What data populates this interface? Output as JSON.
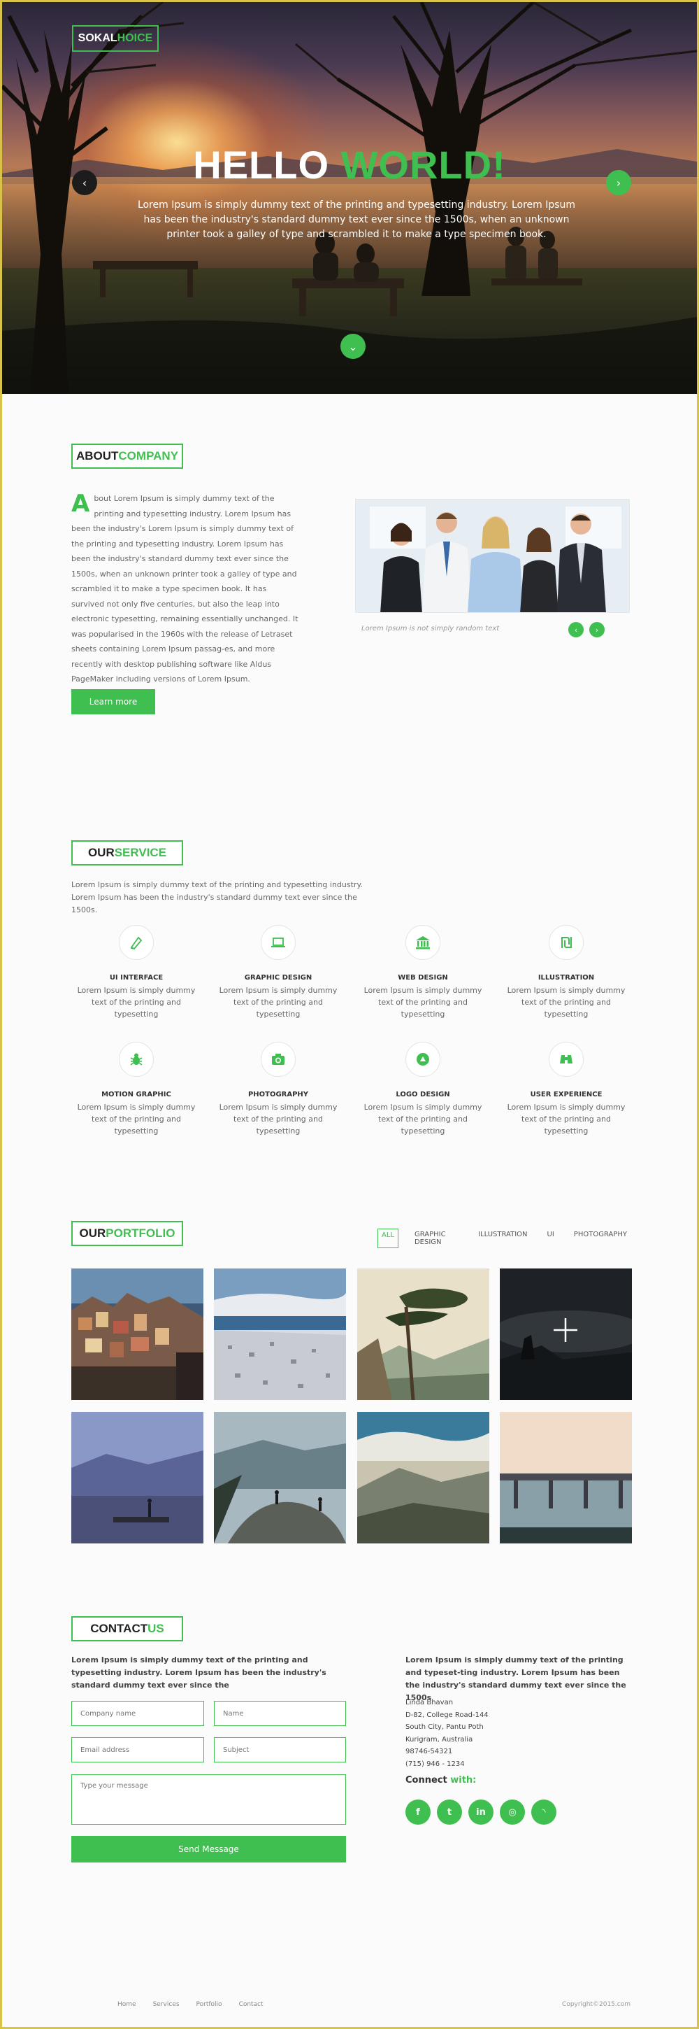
{
  "brand": {
    "logo_part1": "SOKAL ",
    "logo_part2": "HOICE",
    "accent": "#3fbf4f"
  },
  "hero": {
    "title_part1": "HELLO ",
    "title_part2": "WORLD!",
    "text": "Lorem Ipsum is simply dummy text of the printing and typesetting industry. Lorem Ipsum has been the industry's standard dummy text ever since the 1500s, when an unknown printer took a galley of type and scrambled it to make a type specimen book.",
    "prev_icon": "chevron-left-icon",
    "next_icon": "chevron-right-icon",
    "down_icon": "chevron-down-icon"
  },
  "about": {
    "title_part1": "ABOUT ",
    "title_part2": "COMPANY",
    "drop_letter": "A",
    "text": "bout Lorem Ipsum is simply dummy text of the printing and typesetting industry. Lorem Ipsum has been the industry's Lorem Ipsum is simply dummy text of the printing and typesetting industry. Lorem Ipsum has been the industry's standard dummy text ever since the 1500s, when an unknown printer took a galley of type and scrambled it to make a type specimen book. It has survived not only five centuries, but also the leap into electronic typesetting, remaining essentially unchanged. It was popularised in the 1960s with the release of Letraset sheets containing Lorem Ipsum passag-es, and more recently with desktop publishing software like Aldus PageMaker including versions of Lorem Ipsum.",
    "button": "Learn more",
    "caption": "Lorem Ipsum is not simply random text"
  },
  "service": {
    "title_part1": "OUR ",
    "title_part2": "SERVICE",
    "intro": "Lorem Ipsum is simply dummy text of the printing and typesetting industry. Lorem Ipsum has been the industry's standard dummy text ever since the 1500s.",
    "items": [
      {
        "name": "UI INTERFACE",
        "desc": "Lorem Ipsum is simply dummy text of the printing and typesetting",
        "icon": "pen-icon"
      },
      {
        "name": "GRAPHIC DESIGN",
        "desc": "Lorem Ipsum is simply dummy text of the printing and typesetting",
        "icon": "laptop-icon"
      },
      {
        "name": "WEB DESIGN",
        "desc": "Lorem Ipsum is simply dummy text of the printing and typesetting",
        "icon": "bank-icon"
      },
      {
        "name": "ILLUSTRATION",
        "desc": "Lorem Ipsum is simply dummy text of the printing and typesetting",
        "icon": "shekel-icon"
      },
      {
        "name": "MOTION GRAPHIC",
        "desc": "Lorem Ipsum is simply dummy text of the printing and typesetting",
        "icon": "bug-icon"
      },
      {
        "name": "PHOTOGRAPHY",
        "desc": "Lorem Ipsum is simply dummy text of the printing and typesetting",
        "icon": "camera-icon"
      },
      {
        "name": "LOGO DESIGN",
        "desc": "Lorem Ipsum is simply dummy text of the printing and typesetting",
        "icon": "logo-badge-icon"
      },
      {
        "name": "USER EXPERIENCE",
        "desc": "Lorem Ipsum is simply dummy text of the printing and typesetting",
        "icon": "binoculars-icon"
      }
    ]
  },
  "portfolio": {
    "title_part1": "OUR ",
    "title_part2": "PORTFOLIO",
    "filters": [
      "ALL",
      "GRAPHIC DESIGN",
      "ILLUSTRATION",
      "UI",
      "PHOTOGRAPHY"
    ],
    "active_filter": "ALL",
    "overlay_icon": "plus-icon"
  },
  "contact": {
    "title_part1": "CONTACT ",
    "title_part2": "US",
    "intro": "Lorem Ipsum is simply dummy text of the printing and typesetting industry. Lorem Ipsum has been the industry's standard dummy text ever since the",
    "placeholders": {
      "company": "Company name",
      "name": "Name",
      "email": "Email address",
      "subject": "Subject",
      "message": "Type your message"
    },
    "send_button": "Send Message",
    "right_intro": "Lorem Ipsum is simply dummy text of the printing and typeset-ting industry. Lorem Ipsum has been the industry's standard dummy text ever since the 1500s",
    "address": [
      "Linda Bhavan",
      "D-82, College Road-144",
      "South City, Pantu Poth",
      "Kurigram,  Australia",
      "98746-54321",
      "(715) 946 - 1234"
    ],
    "connect_part1": "Connect ",
    "connect_part2": "with:",
    "social": [
      {
        "name": "facebook-icon",
        "glyph": "f"
      },
      {
        "name": "twitter-icon",
        "glyph": "t"
      },
      {
        "name": "linkedin-icon",
        "glyph": "in"
      },
      {
        "name": "dribbble-icon",
        "glyph": "◎"
      },
      {
        "name": "rss-icon",
        "glyph": "◝"
      }
    ]
  },
  "footer": {
    "nav": [
      "Home",
      "Services",
      "Portfolio",
      "Contact"
    ],
    "copyright": "Copyright©2015.com"
  }
}
